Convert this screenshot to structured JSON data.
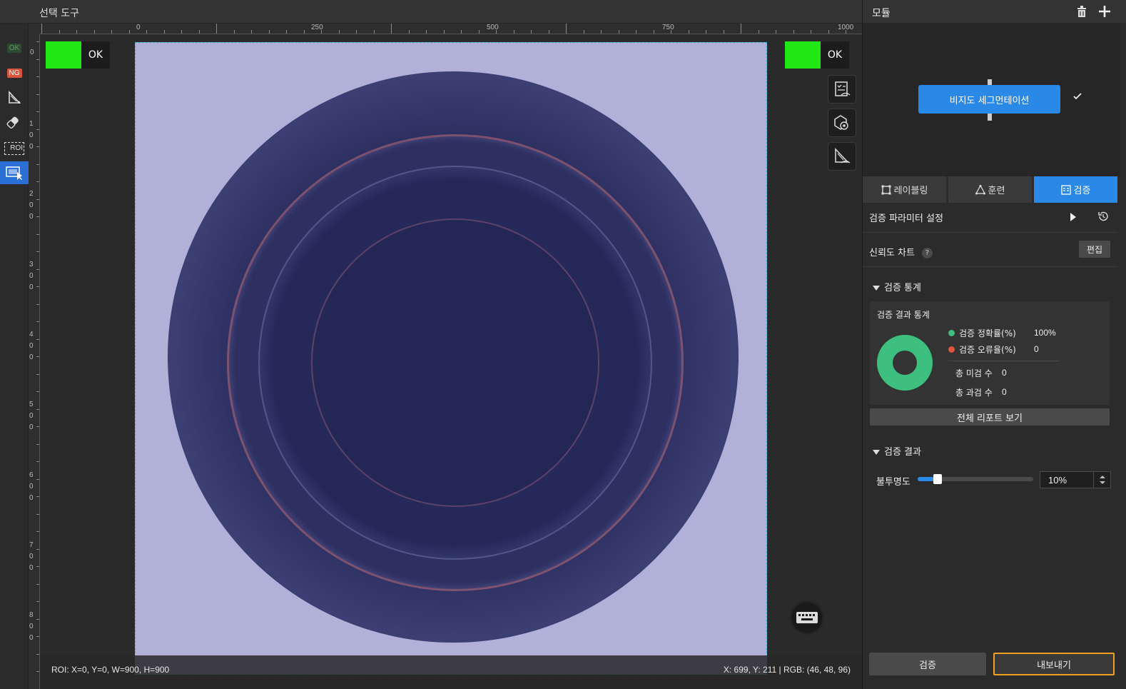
{
  "window": {
    "title": "선택 도구"
  },
  "toolbar": {
    "ok_label": "OK",
    "ng_label": "NG",
    "roi_label": "ROI"
  },
  "ruler": {
    "top_labels": [
      "0",
      "250",
      "500",
      "750",
      "1000"
    ],
    "left_labels": [
      "0",
      "100",
      "200",
      "300",
      "400",
      "500",
      "600",
      "700",
      "800"
    ]
  },
  "canvas": {
    "left_chip": {
      "label": "OK",
      "color": "#21e815"
    },
    "right_chip": {
      "label": "OK",
      "color": "#21e815"
    },
    "status_left": "ROI: X=0, Y=0, W=900, H=900",
    "status_right": "X: 699, Y: 211 | RGB: (46, 48, 96)"
  },
  "panel": {
    "title": "모듈",
    "flow_node": "비지도 세그먼테이션",
    "tabs": [
      {
        "label": "레이블링"
      },
      {
        "label": "훈련"
      },
      {
        "label": "검증"
      }
    ],
    "param_settings": "검증 파라미터 설정",
    "confidence_chart": "신뢰도 차트",
    "help_glyph": "?",
    "edit_label": "편집",
    "stats_section": "검증 통계",
    "stats_box_title": "검증 결과 통계",
    "accuracy_label": "검증 정확률(%)",
    "accuracy_value": "100%",
    "error_label": "검증 오류율(%)",
    "error_value": "0",
    "missed_label": "총 미검 수",
    "missed_value": "0",
    "overkill_label": "총 과검 수",
    "overkill_value": "0",
    "report_button": "전체 리포트 보기",
    "result_section": "검증 결과",
    "opacity_label": "불투명도",
    "opacity_value": "10%",
    "opacity_fraction": 0.1,
    "verify_button": "검증",
    "export_button": "내보내기"
  },
  "colors": {
    "accent": "#2a88e6",
    "accuracy": "#3cbf7f",
    "error": "#e0553a",
    "highlight": "#f0a020"
  }
}
